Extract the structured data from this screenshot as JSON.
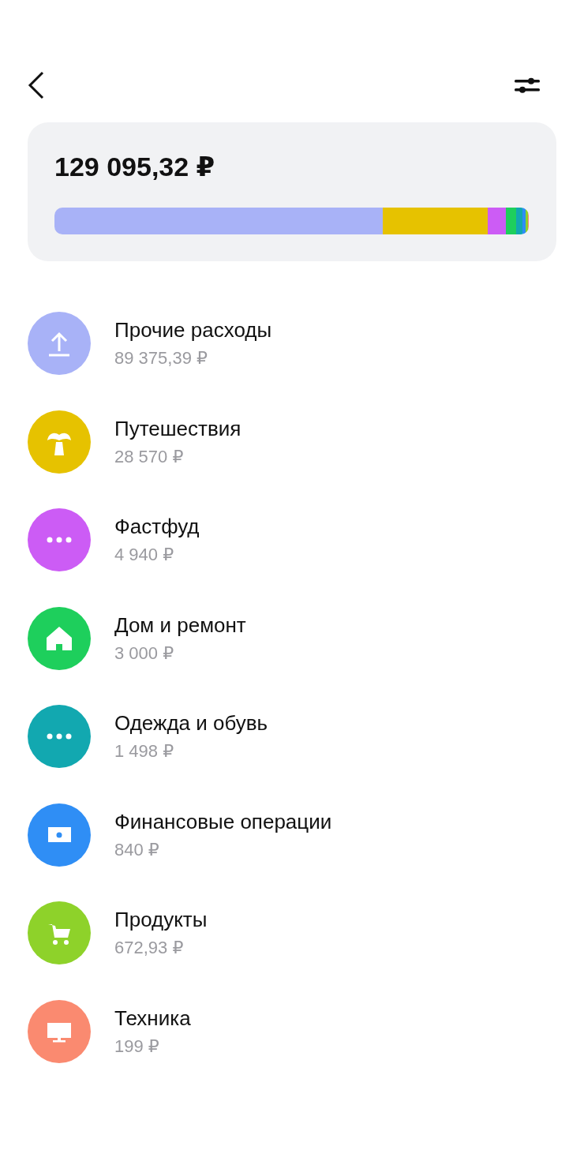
{
  "summary": {
    "total": "129 095,32 ₽"
  },
  "categories": [
    {
      "name": "Прочие расходы",
      "amount": "89 375,39 ₽",
      "color": "#a8b2f7",
      "kind": "upload"
    },
    {
      "name": "Путешествия",
      "amount": "28 570 ₽",
      "color": "#e6c200",
      "kind": "palm"
    },
    {
      "name": "Фастфуд",
      "amount": "4 940 ₽",
      "color": "#cc5cf5",
      "kind": "dots"
    },
    {
      "name": "Дом и ремонт",
      "amount": "3 000 ₽",
      "color": "#1ecf5c",
      "kind": "house"
    },
    {
      "name": "Одежда и обувь",
      "amount": "1 498 ₽",
      "color": "#12a8b0",
      "kind": "dots"
    },
    {
      "name": "Финансовые операции",
      "amount": "840 ₽",
      "color": "#2f8ef5",
      "kind": "banknote"
    },
    {
      "name": "Продукты",
      "amount": "672,93 ₽",
      "color": "#8ed22a",
      "kind": "cart"
    },
    {
      "name": "Техника",
      "amount": "199 ₽",
      "color": "#fa8a70",
      "kind": "monitor"
    }
  ]
}
